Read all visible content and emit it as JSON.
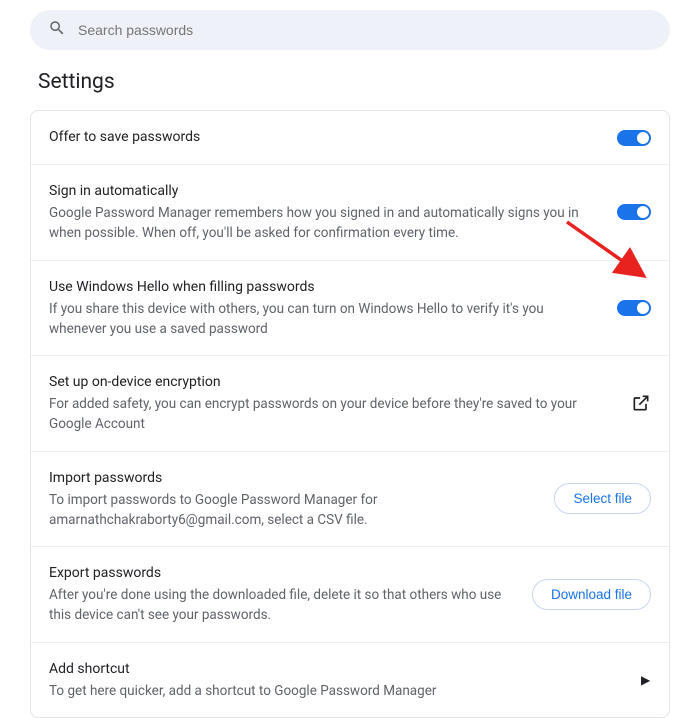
{
  "search": {
    "placeholder": "Search passwords"
  },
  "heading": "Settings",
  "rows": {
    "offer": {
      "title": "Offer to save passwords"
    },
    "auto": {
      "title": "Sign in automatically",
      "desc": "Google Password Manager remembers how you signed in and automatically signs you in when possible. When off, you'll be asked for confirmation every time."
    },
    "hello": {
      "title": "Use Windows Hello when filling passwords",
      "desc": "If you share this device with others, you can turn on Windows Hello to verify it's you whenever you use a saved password"
    },
    "encrypt": {
      "title": "Set up on-device encryption",
      "desc": "For added safety, you can encrypt passwords on your device before they're saved to your Google Account"
    },
    "import": {
      "title": "Import passwords",
      "desc": "To import passwords to Google Password Manager for amarnathchakraborty6@gmail.com, select a CSV file.",
      "button": "Select file"
    },
    "export": {
      "title": "Export passwords",
      "desc": "After you're done using the downloaded file, delete it so that others who use this device can't see your passwords.",
      "button": "Download file"
    },
    "shortcut": {
      "title": "Add shortcut",
      "desc": "To get here quicker, add a shortcut to Google Password Manager"
    }
  },
  "colors": {
    "accent": "#1a73e8"
  }
}
